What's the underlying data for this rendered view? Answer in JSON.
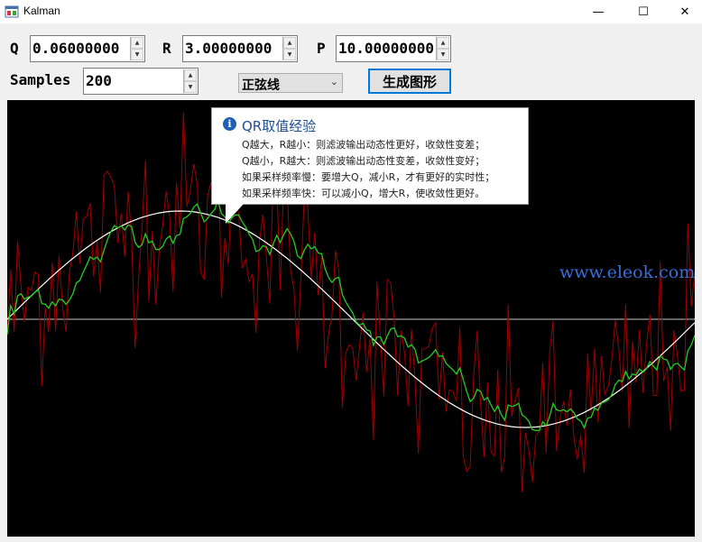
{
  "window": {
    "title": "Kalman",
    "minimize_glyph": "—",
    "maximize_glyph": "☐",
    "close_glyph": "✕",
    "icon": "app-window-icon"
  },
  "params": {
    "q_label": "Q",
    "q_value": "0.06000000",
    "r_label": "R",
    "r_value": "3.00000000",
    "p_label": "P",
    "p_value": "10.00000000",
    "samples_label": "Samples",
    "samples_value": "200",
    "spin_up": "▲",
    "spin_down": "▼"
  },
  "waveform": {
    "selected": "正弦线",
    "arrow": "⌄"
  },
  "generate_button": "生成图形",
  "tooltip": {
    "icon": "i",
    "title": "QR取值经验",
    "lines": [
      "Q越大，R越小：则滤波输出动态性更好，收敛性变差；",
      "Q越小，R越大：则滤波输出动态性变差，收敛性变好；",
      "如果采样频率慢：要增大Q，减小R，才有更好的实时性；",
      "如果采样频率快：可以减小Q，增大R，使收敛性更好。"
    ]
  },
  "watermark": "www.eleok.com",
  "colors": {
    "background": "#000000",
    "axis": "#c8c8c8",
    "true_signal": "#ffffff",
    "measurement": "#a00000",
    "kalman": "#22cc22",
    "accent": "#0078d7"
  },
  "chart_data": {
    "type": "line",
    "samples": 200,
    "ylim": [
      -1.8,
      1.8
    ],
    "series": [
      {
        "name": "",
        "kind": "true_signal",
        "values": []
      },
      {
        "name": "",
        "kind": "measurement",
        "values": []
      },
      {
        "name": "",
        "kind": "kalman_estimate",
        "values": []
      }
    ]
  }
}
